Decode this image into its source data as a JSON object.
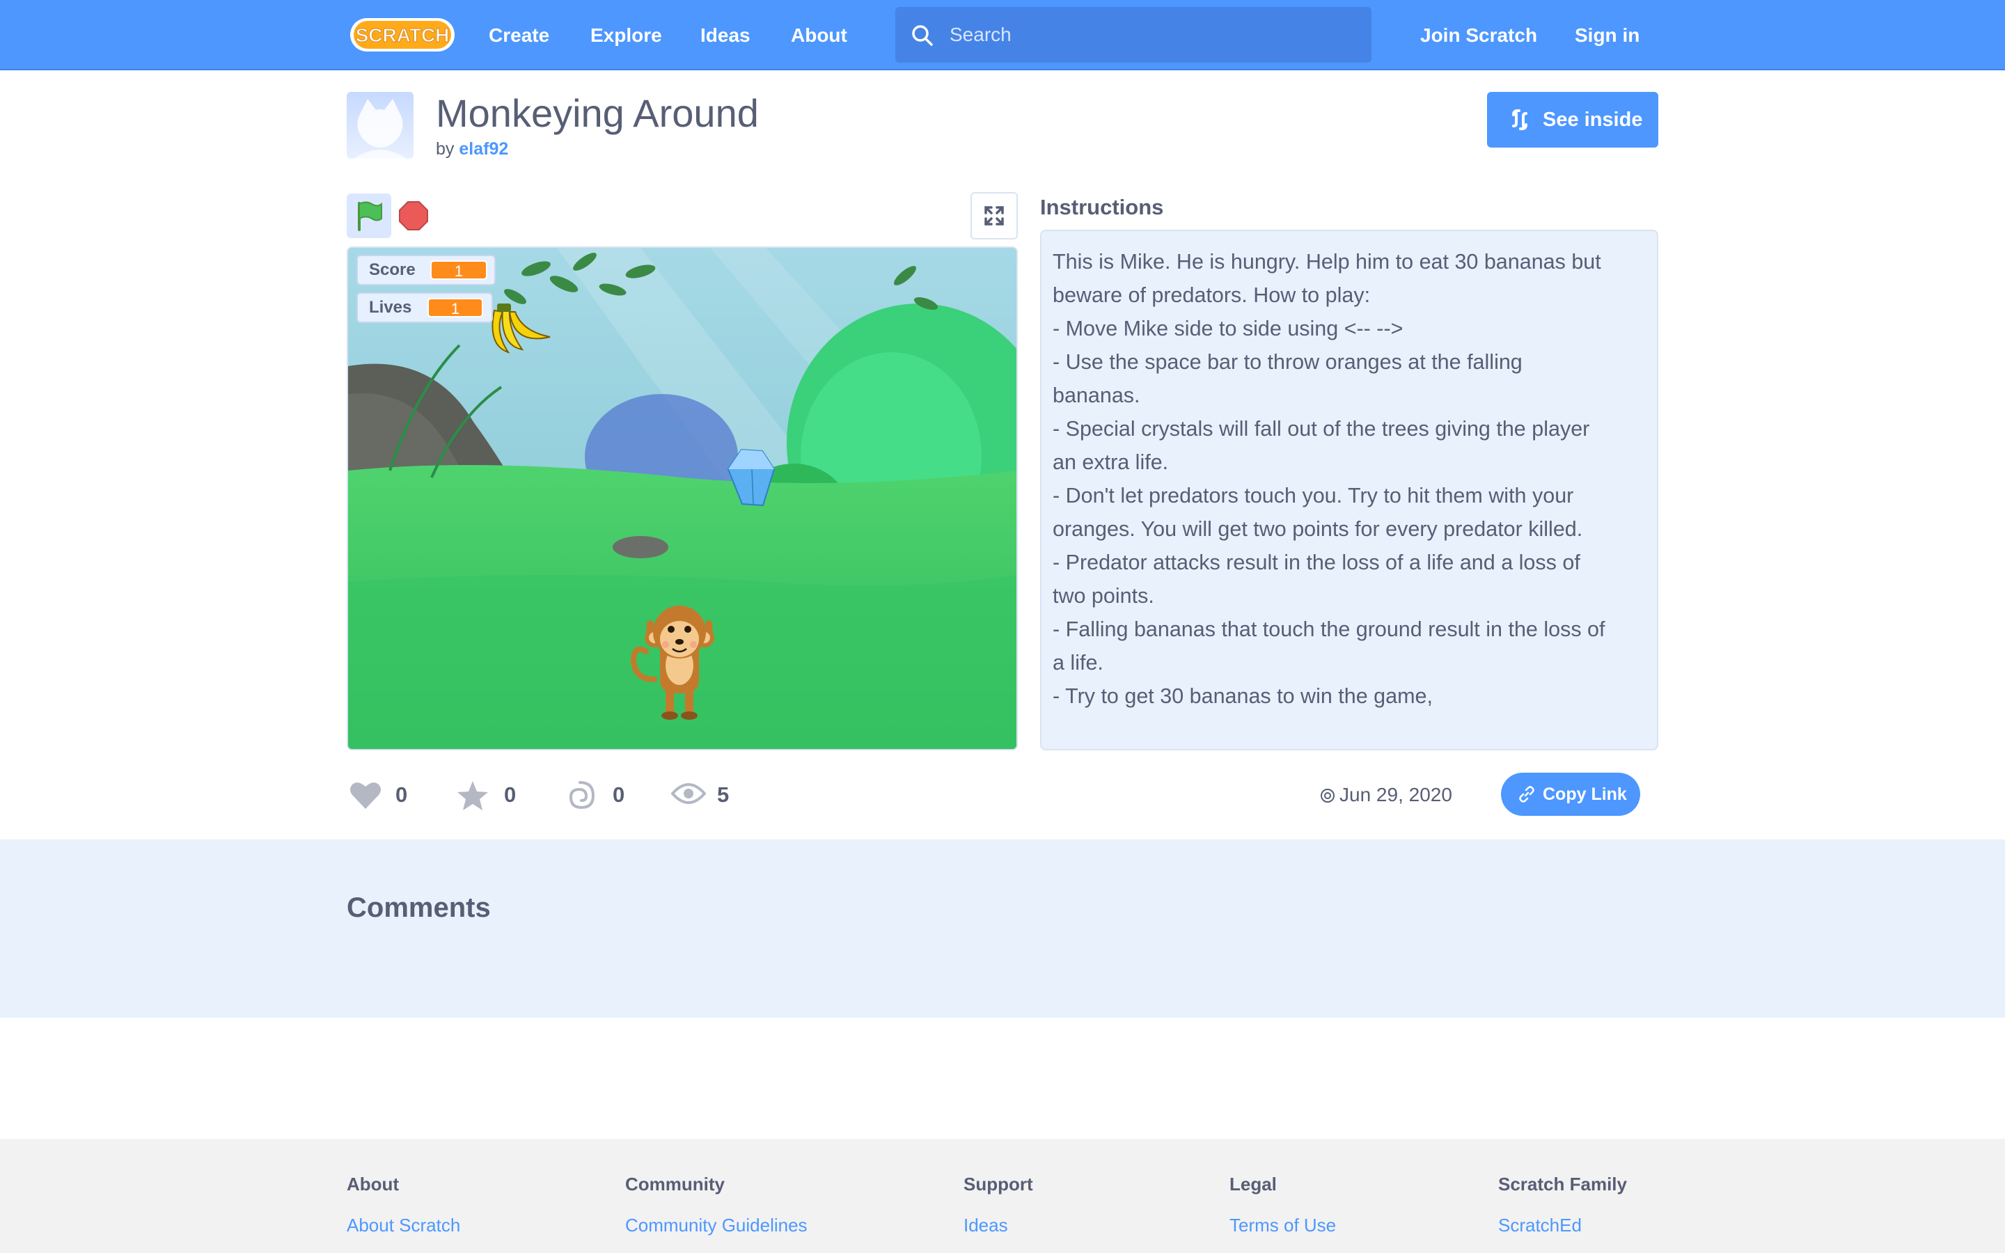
{
  "nav": {
    "logo_text": "SCRATCH",
    "links": [
      "Create",
      "Explore",
      "Ideas",
      "About"
    ],
    "search_placeholder": "Search",
    "join": "Join Scratch",
    "sign_in": "Sign in"
  },
  "project": {
    "title": "Monkeying Around",
    "by_label": "by",
    "author": "elaf92",
    "see_inside": "See inside"
  },
  "stage": {
    "monitors": [
      {
        "label": "Score",
        "value": "1"
      },
      {
        "label": "Lives",
        "value": "1"
      }
    ]
  },
  "instructions": {
    "heading": "Instructions",
    "lines": [
      "This is Mike. He is hungry. Help him to eat 30 bananas but",
      "beware of predators. How to play:",
      "- Move Mike side to side using <-- -->",
      "- Use the space bar to throw oranges at the falling",
      "bananas.",
      "- Special crystals will fall out of the trees giving the player",
      "an extra life.",
      "- Don't let predators touch you. Try to hit them with your",
      "oranges. You will get two points for every predator killed.",
      "- Predator attacks result in the loss of a life and a loss of",
      "two points.",
      "- Falling bananas that touch the ground result in the loss of",
      "a life.",
      "- Try to get 30 bananas to win the game,"
    ]
  },
  "stats": {
    "loves": "0",
    "favorites": "0",
    "remixes": "0",
    "views": "5",
    "shared_date": "Jun 29, 2020",
    "copy_link": "Copy Link"
  },
  "comments": {
    "heading": "Comments"
  },
  "footer": {
    "columns": [
      {
        "heading": "About",
        "link": "About Scratch"
      },
      {
        "heading": "Community",
        "link": "Community Guidelines"
      },
      {
        "heading": "Support",
        "link": "Ideas"
      },
      {
        "heading": "Legal",
        "link": "Terms of Use"
      },
      {
        "heading": "Scratch Family",
        "link": "ScratchEd"
      }
    ]
  },
  "colors": {
    "brand_blue": "#4d97ff",
    "text": "#575e75",
    "monitor_orange": "#ff8c1a",
    "stop_red": "#ec5959",
    "flag_green": "#4cbf56"
  }
}
